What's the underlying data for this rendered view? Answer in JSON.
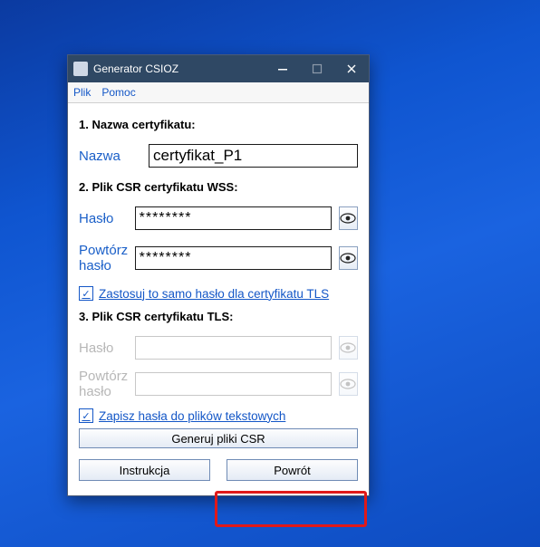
{
  "window": {
    "title": "Generator CSIOZ"
  },
  "menu": {
    "file": "Plik",
    "help": "Pomoc"
  },
  "sec1": {
    "head": "1. Nazwa certyfikatu:",
    "name_label": "Nazwa",
    "name_value": "certyfikat_P1"
  },
  "sec2": {
    "head": "2. Plik CSR certyfikatu WSS:",
    "pass_label": "Hasło",
    "pass_value": "********",
    "repeat_label": "Powtórz hasło",
    "repeat_value": "********",
    "same_tls": "Zastosuj to samo hasło dla certyfikatu TLS"
  },
  "sec3": {
    "head": "3. Plik CSR certyfikatu TLS:",
    "pass_label": "Hasło",
    "repeat_label": "Powtórz hasło",
    "save_txt": "Zapisz hasła do plików tekstowych",
    "generate": "Generuj pliki CSR"
  },
  "footer": {
    "instr": "Instrukcja",
    "back": "Powrót"
  }
}
